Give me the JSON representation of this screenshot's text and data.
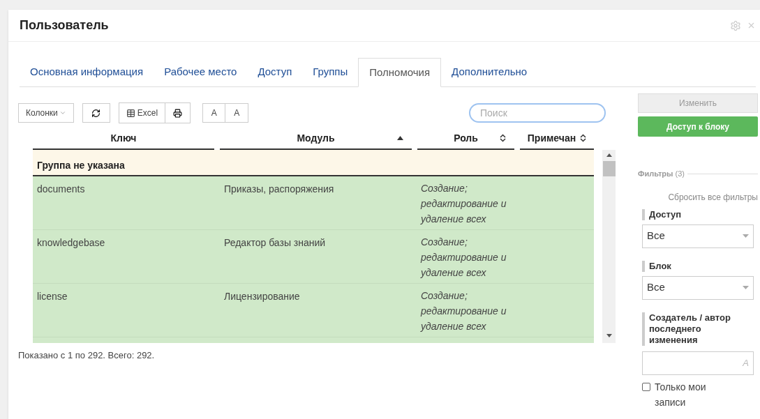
{
  "window": {
    "title": "Пользователь"
  },
  "tabs": [
    {
      "label": "Основная информация",
      "selected": false
    },
    {
      "label": "Рабочее место",
      "selected": false
    },
    {
      "label": "Доступ",
      "selected": false
    },
    {
      "label": "Группы",
      "selected": false
    },
    {
      "label": "Полномочия",
      "selected": true
    },
    {
      "label": "Дополнительно",
      "selected": false
    }
  ],
  "toolbar": {
    "columns_button": "Колонки",
    "excel_button": "Excel",
    "font_buttons": [
      "A",
      "A"
    ],
    "search": {
      "placeholder": "Поиск"
    }
  },
  "table": {
    "columns": [
      {
        "label": "Ключ",
        "sortable": false
      },
      {
        "label": "Модуль",
        "sortable": true,
        "sorted_ascending": true
      },
      {
        "label": "Роль",
        "sortable": true,
        "sorted_ascending": false
      },
      {
        "label": "Примечан",
        "sortable": true,
        "sorted_ascending": false
      }
    ],
    "group": "Группа не указана",
    "rows": [
      {
        "key": "documents",
        "module": "Приказы, распоряжения",
        "role": "Создание; редактирование и удаление всех"
      },
      {
        "key": "knowledgebase",
        "module": "Редактор базы знаний",
        "role": "Создание; редактирование и удаление всех"
      },
      {
        "key": "license",
        "module": "Лицензирование",
        "role": "Создание; редактирование и удаление всех"
      }
    ],
    "footer": "Показано с 1 по 292. Всего: 292."
  },
  "side": {
    "edit_button": {
      "label": "Изменить",
      "disabled": true
    },
    "access_button": "Доступ к блоку",
    "filters_title": "Фильтры",
    "filters_count": "(3)",
    "reset": "Сбросить все фильтры",
    "filters": [
      {
        "kind": "select",
        "label": "Доступ",
        "value": "Все"
      },
      {
        "kind": "select",
        "label": "Блок",
        "value": "Все"
      },
      {
        "kind": "text",
        "label": "Создатель / автор последнего изменения",
        "icon_text": "A"
      }
    ],
    "only_mine": {
      "label": "Только мои записи",
      "checked": false
    }
  }
}
